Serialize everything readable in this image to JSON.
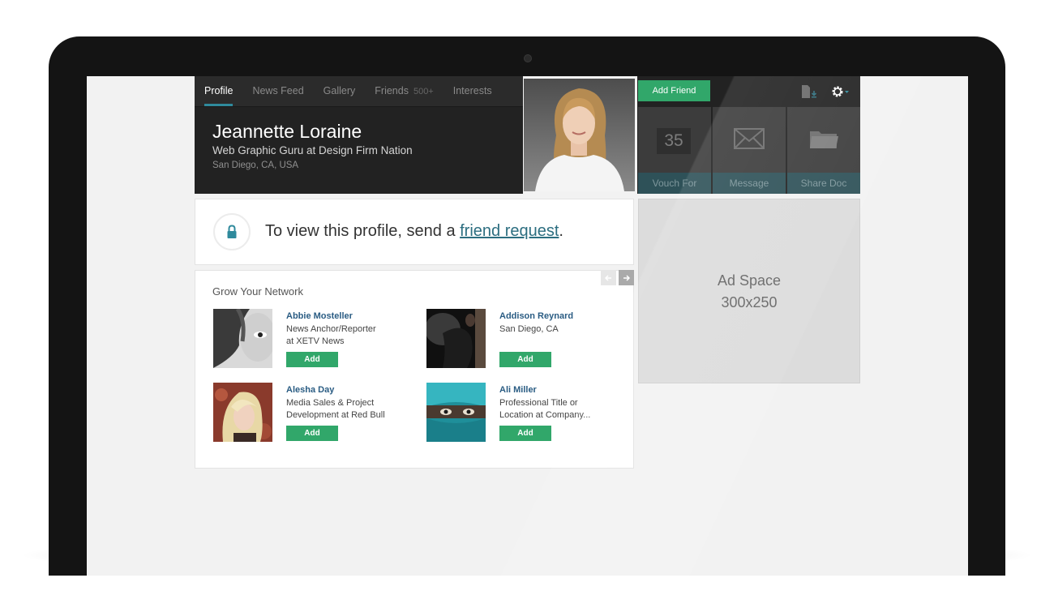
{
  "nav": {
    "tabs": [
      {
        "label": "Profile",
        "count": ""
      },
      {
        "label": "News Feed",
        "count": ""
      },
      {
        "label": "Gallery",
        "count": ""
      },
      {
        "label": "Friends",
        "count": "500+"
      },
      {
        "label": "Interests",
        "count": ""
      }
    ]
  },
  "profile": {
    "name": "Jeannette Loraine",
    "title": "Web Graphic Guru at Design Firm Nation",
    "location": "San Diego, CA, USA"
  },
  "actions": {
    "add_friend_label": "Add Friend",
    "tiles": [
      {
        "label": "Vouch For",
        "badge": "35",
        "icon": "vouch-badge"
      },
      {
        "label": "Message",
        "icon": "envelope-icon"
      },
      {
        "label": "Share Doc",
        "icon": "folder-icon"
      }
    ]
  },
  "notice": {
    "prefix": "To view this profile, send a ",
    "link": "friend request",
    "suffix": "."
  },
  "network": {
    "title": "Grow Your Network",
    "add_label": "Add",
    "people": [
      {
        "name": "Abbie Mosteller",
        "desc_line1": "News Anchor/Reporter",
        "desc_line2": "at XETV News"
      },
      {
        "name": "Addison Reynard",
        "desc_line1": "San Diego, CA",
        "desc_line2": ""
      },
      {
        "name": "Alesha Day",
        "desc_line1": "Media Sales & Project",
        "desc_line2": "Development at Red Bull"
      },
      {
        "name": "Ali Miller",
        "desc_line1": "Professional Title or",
        "desc_line2": "Location at Company..."
      }
    ]
  },
  "ad": {
    "line1": "Ad Space",
    "line2": "300x250"
  },
  "colors": {
    "accent_green": "#31a76a",
    "accent_teal": "#2f8a9c",
    "link_blue": "#2a5c83"
  }
}
